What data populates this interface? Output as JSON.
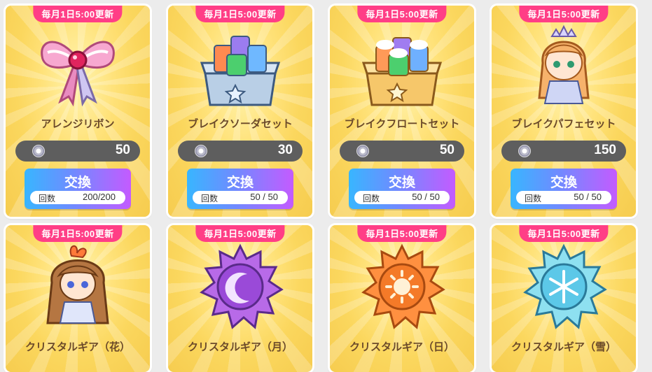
{
  "cards": [
    {
      "badge": "毎月1日5:00更新",
      "name": "アレンジリボン",
      "price": "50",
      "exchange_label": "交換",
      "count_label": "回数",
      "count": "200/200",
      "art_icon": "ribbon-icon"
    },
    {
      "badge": "毎月1日5:00更新",
      "name": "ブレイクソーダセット",
      "price": "30",
      "exchange_label": "交換",
      "count_label": "回数",
      "count": "50 / 50",
      "art_icon": "soda-set-icon"
    },
    {
      "badge": "毎月1日5:00更新",
      "name": "ブレイクフロートセット",
      "price": "50",
      "exchange_label": "交換",
      "count_label": "回数",
      "count": "50 / 50",
      "art_icon": "float-set-icon"
    },
    {
      "badge": "毎月1日5:00更新",
      "name": "ブレイクパフェセット",
      "price": "150",
      "exchange_label": "交換",
      "count_label": "回数",
      "count": "50 / 50",
      "art_icon": "princess-character-icon"
    },
    {
      "badge": "毎月1日5:00更新",
      "name": "クリスタルギア（花）",
      "art_icon": "character-crystal-flower-icon"
    },
    {
      "badge": "毎月1日5:00更新",
      "name": "クリスタルギア（月）",
      "art_icon": "gear-moon-icon"
    },
    {
      "badge": "毎月1日5:00更新",
      "name": "クリスタルギア（日）",
      "art_icon": "gear-sun-icon"
    },
    {
      "badge": "毎月1日5:00更新",
      "name": "クリスタルギア（雪）",
      "art_icon": "gear-snow-icon"
    }
  ],
  "colors": {
    "badge": "#ff3e86",
    "price_bar": "#5e5e5e",
    "button_start": "#38b6ff",
    "button_end": "#c45bff"
  }
}
